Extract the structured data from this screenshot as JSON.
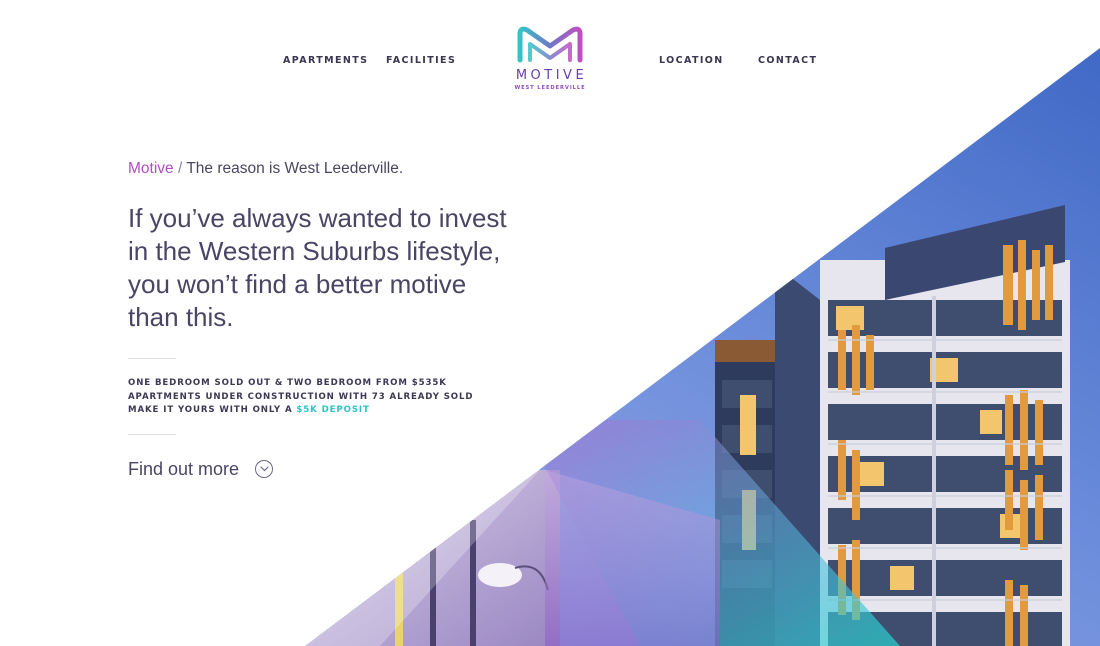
{
  "nav": {
    "links": [
      {
        "label": "APARTMENTS"
      },
      {
        "label": "FACILITIES"
      },
      {
        "label": "LOCATION"
      },
      {
        "label": "CONTACT"
      }
    ]
  },
  "logo": {
    "wordmark": "MOTIVE",
    "sub": "WEST LEEDERVILLE",
    "icon": "m-monogram-logo"
  },
  "hero": {
    "breadcrumb_brand": "Motive",
    "breadcrumb_sep": "/",
    "breadcrumb_text": "The reason is West Leederville.",
    "headline": "If you’ve always wanted to invest in the Western Suburbs lifestyle, you won’t find a better motive than this.",
    "stats": [
      "ONE BEDROOM SOLD OUT & TWO BEDROOM FROM $535K",
      "APARTMENTS UNDER CONSTRUCTION WITH 73 ALREADY SOLD"
    ],
    "stats_last_prefix": "MAKE IT YOURS WITH ONLY A",
    "stats_last_accent": "$5K DEPOSIT",
    "cta_label": "Find out more",
    "cta_icon": "chevron-down-circle-icon"
  },
  "colors": {
    "accent_teal": "#2fc3c9",
    "accent_purple": "#b04fc0",
    "sky_blue": "#3d68c4",
    "text_dark": "#3f3a5c"
  }
}
